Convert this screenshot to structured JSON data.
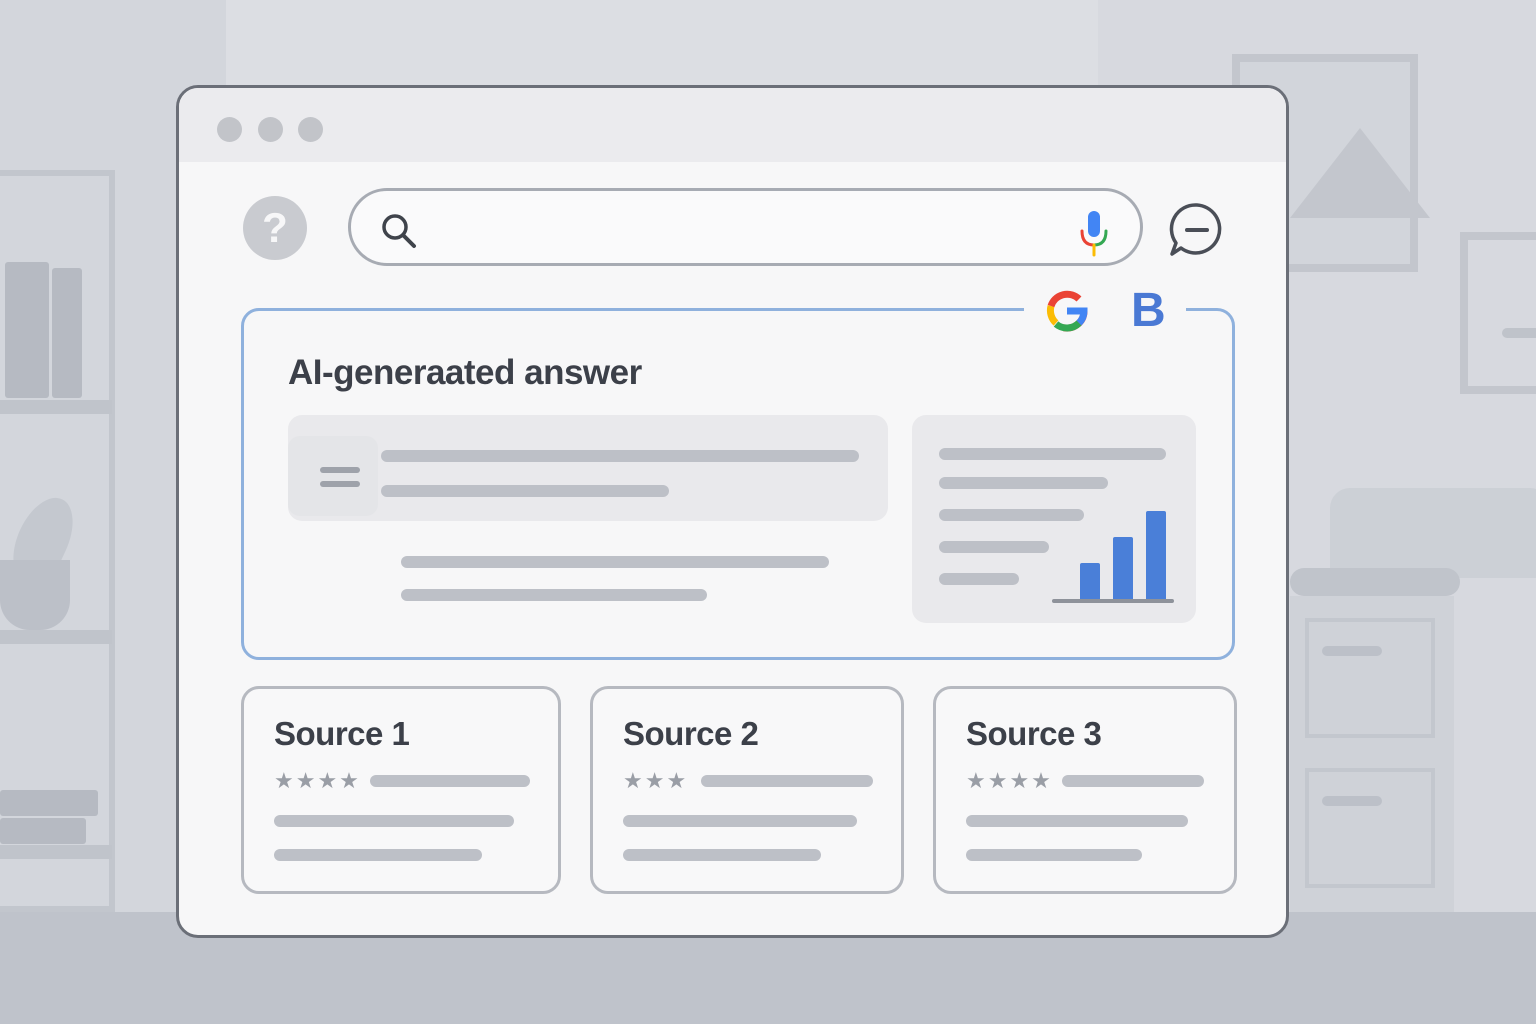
{
  "search": {
    "placeholder": "",
    "value": ""
  },
  "ai_answer": {
    "title": "AI-generaated answer",
    "brands": [
      "G",
      "B"
    ]
  },
  "sources": [
    {
      "title": "Source 1",
      "stars": "★★★★"
    },
    {
      "title": "Source 2",
      "stars": "★★★"
    },
    {
      "title": "Source 3",
      "stars": "★★★★"
    }
  ],
  "icons": {
    "help": "question-mark",
    "search": "magnifier",
    "mic": "microphone",
    "chat": "chat-bubble",
    "query": "q-magnifier",
    "document": "document-lines",
    "chart": "bar-chart"
  },
  "colors": {
    "accent": "#4a7fd8",
    "panel_border": "#8fb1dd",
    "google_blue": "#4285F4",
    "google_red": "#EA4335",
    "google_yellow": "#FBBC05",
    "google_green": "#34A853"
  },
  "chart_data": {
    "type": "bar",
    "categories": [
      "",
      "",
      ""
    ],
    "values": [
      35,
      60,
      85
    ],
    "ylim": [
      0,
      100
    ]
  }
}
